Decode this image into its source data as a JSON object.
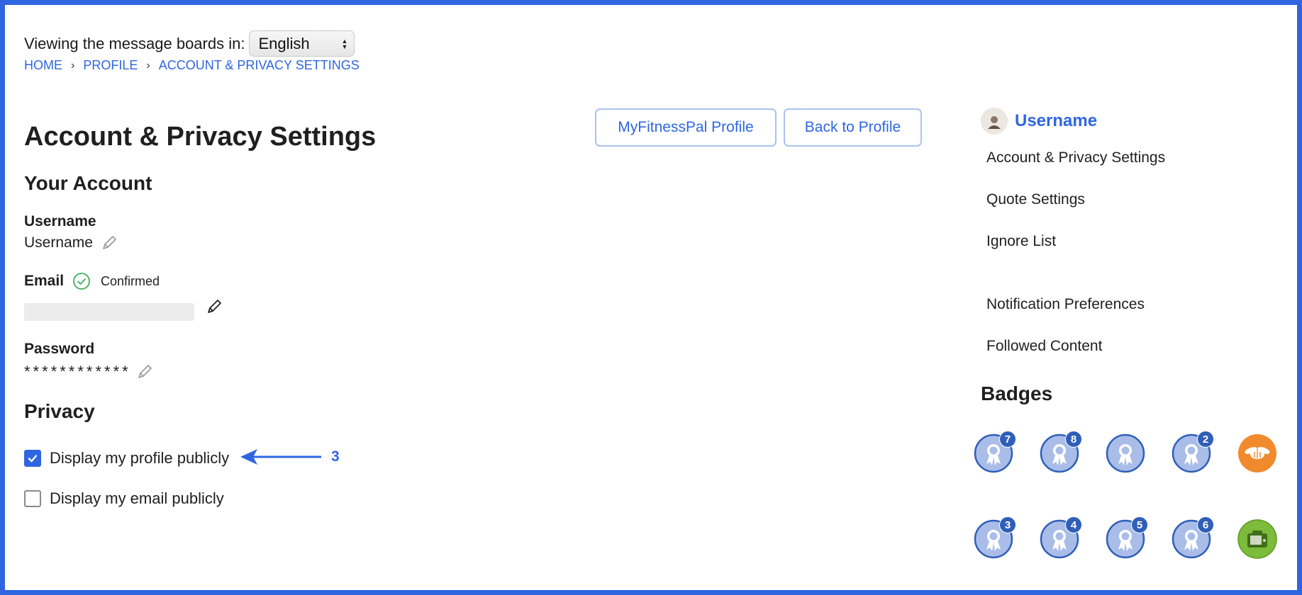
{
  "header": {
    "viewing_label": "Viewing the message boards in:",
    "language_selected": "English"
  },
  "breadcrumb": [
    "HOME",
    "PROFILE",
    "ACCOUNT & PRIVACY SETTINGS"
  ],
  "breadcrumb_separator": "›",
  "page_title": "Account & Privacy Settings",
  "actions": {
    "mfp_profile": "MyFitnessPal Profile",
    "back_to_profile": "Back to Profile"
  },
  "account": {
    "section_title": "Your Account",
    "username_label": "Username",
    "username_value": "Username",
    "email_label": "Email",
    "email_status": "Confirmed",
    "password_label": "Password",
    "password_value": "************"
  },
  "privacy": {
    "section_title": "Privacy",
    "options": [
      {
        "label": "Display my profile publicly",
        "checked": true
      },
      {
        "label": "Display my email publicly",
        "checked": false
      }
    ]
  },
  "annotation": {
    "number": "3",
    "color": "#2f66e0"
  },
  "sidebar": {
    "username": "Username",
    "links": [
      "Account & Privacy Settings",
      "Quote Settings",
      "Ignore List",
      "Notification Preferences",
      "Followed Content"
    ]
  },
  "badges": {
    "title": "Badges",
    "items": [
      {
        "type": "ribbon-icon",
        "count": "7"
      },
      {
        "type": "ribbon-icon",
        "count": "8"
      },
      {
        "type": "ribbon-icon",
        "count": ""
      },
      {
        "type": "ribbon-icon",
        "count": "2"
      },
      {
        "type": "bee-icon",
        "count": ""
      },
      {
        "type": "ribbon-icon",
        "count": "3"
      },
      {
        "type": "ribbon-icon",
        "count": "4"
      },
      {
        "type": "ribbon-icon",
        "count": "5"
      },
      {
        "type": "ribbon-icon",
        "count": "6"
      },
      {
        "type": "camera-icon",
        "count": ""
      }
    ]
  },
  "colors": {
    "accent": "#2f66e0",
    "border": "#2f66e0",
    "badge_blue": "#a9bde8",
    "badge_orange": "#f08a2c",
    "badge_green": "#7dbb3a"
  }
}
